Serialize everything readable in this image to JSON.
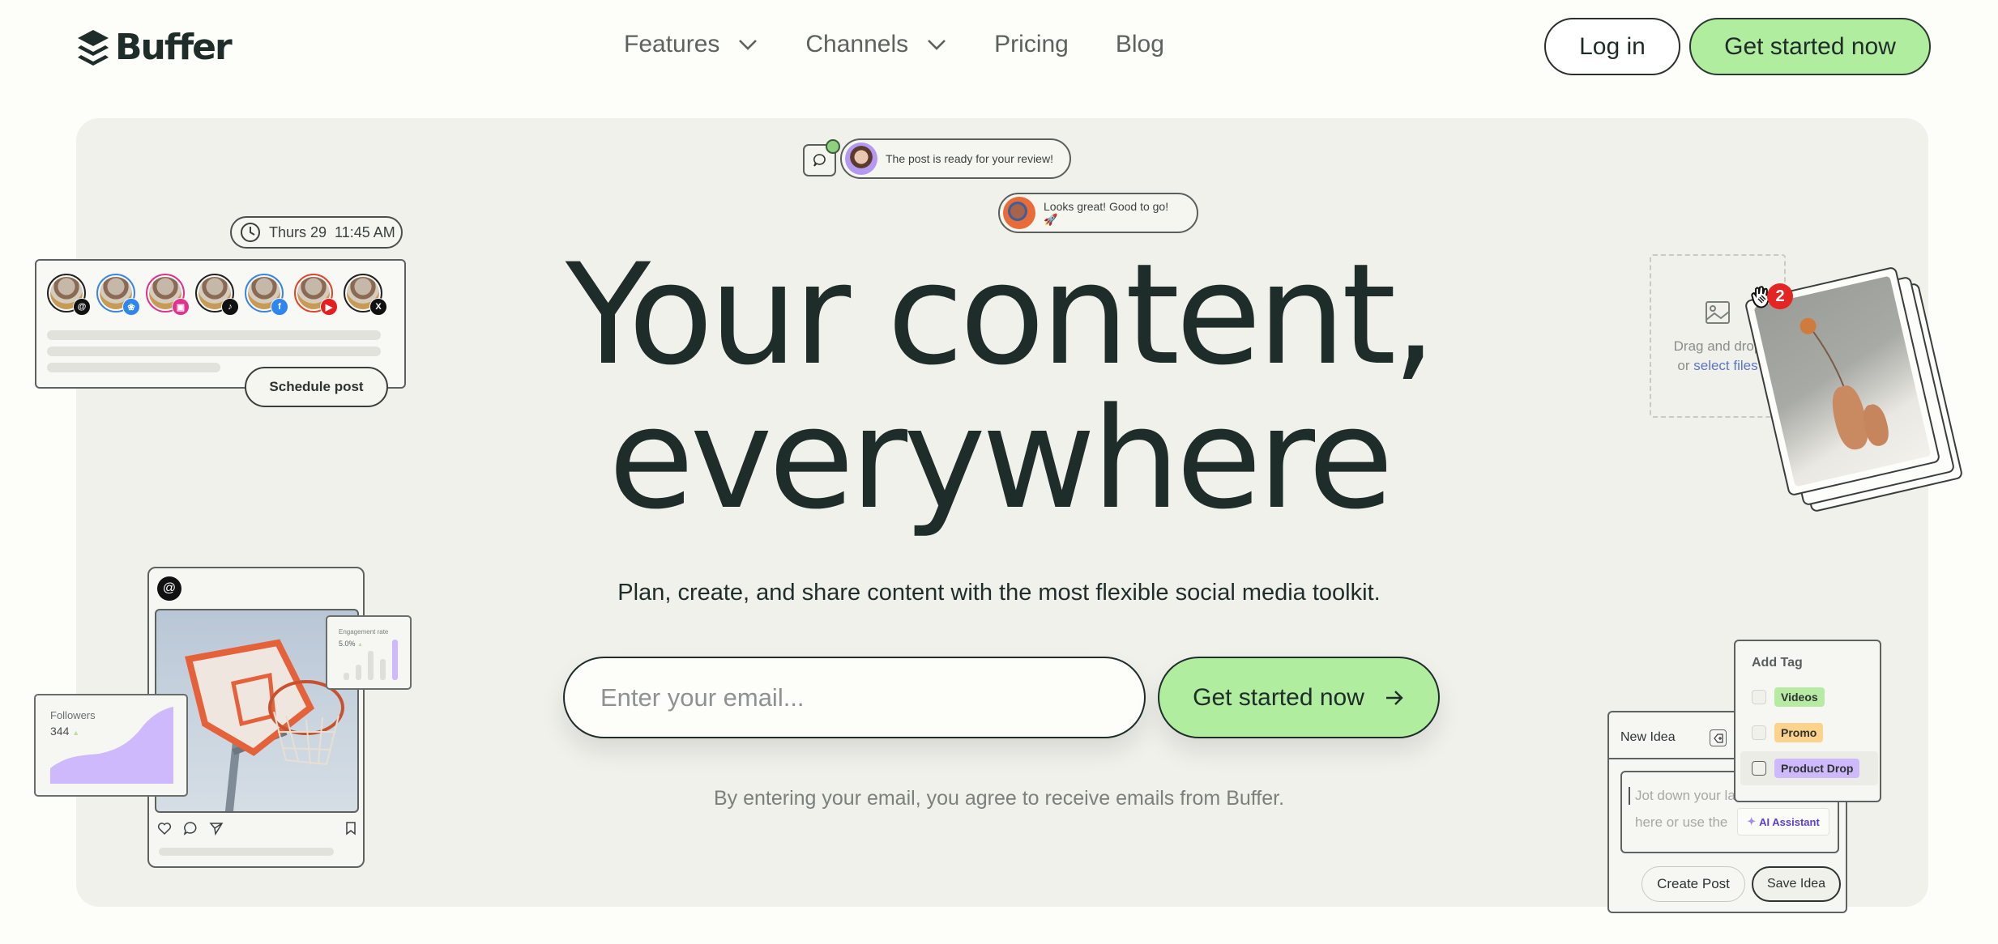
{
  "brand": {
    "name": "Buffer",
    "accent": "#b1ed9e",
    "text": "#1f2d2a",
    "hero_bg": "#f1f1ec"
  },
  "nav": {
    "items": [
      {
        "label": "Features",
        "has_dropdown": true
      },
      {
        "label": "Channels",
        "has_dropdown": true
      },
      {
        "label": "Pricing",
        "has_dropdown": false
      },
      {
        "label": "Blog",
        "has_dropdown": false
      }
    ],
    "login_label": "Log in",
    "cta_label": "Get started now"
  },
  "hero": {
    "headline_line1": "Your content,",
    "headline_line2": "everywhere",
    "subheadline": "Plan, create, and share content with the most flexible social media toolkit.",
    "email_placeholder": "Enter your email...",
    "email_value": "",
    "cta_label": "Get started now",
    "disclaimer": "By entering your email, you agree to receive emails from Buffer."
  },
  "chat": {
    "message1": "The post is ready for your review!",
    "message2": "Looks great! Good to go! 🚀"
  },
  "schedule_card": {
    "date_label": "Thurs 29",
    "time_label": "11:45 AM",
    "button_label": "Schedule post",
    "channels": [
      {
        "name": "threads",
        "ring": "#222222",
        "badge": "#111111",
        "glyph": "@"
      },
      {
        "name": "bluesky",
        "ring": "#3a86e0",
        "badge": "#2f86ee",
        "glyph": "❀"
      },
      {
        "name": "instagram",
        "ring": "#e0338e",
        "badge": "#e0338e",
        "glyph": "▣"
      },
      {
        "name": "tiktok",
        "ring": "#222222",
        "badge": "#111111",
        "glyph": "♪"
      },
      {
        "name": "facebook",
        "ring": "#3a86e0",
        "badge": "#2f86ee",
        "glyph": "f"
      },
      {
        "name": "youtube",
        "ring": "#e0442f",
        "badge": "#e41f1f",
        "glyph": "▶"
      },
      {
        "name": "x",
        "ring": "#222222",
        "badge": "#111111",
        "glyph": "X"
      }
    ]
  },
  "post_card": {
    "network": "threads"
  },
  "engagement_card": {
    "title": "Engagement rate",
    "value": "5.0%",
    "trend": "up",
    "bars": [
      0.18,
      0.38,
      0.72,
      0.52,
      1.0
    ]
  },
  "followers_card": {
    "title": "Followers",
    "value": "344",
    "trend": "up"
  },
  "upload": {
    "line1": "Drag and drop",
    "line2_prefix": "or ",
    "line2_link": "select files",
    "badge_count": "2"
  },
  "idea_card": {
    "title": "New Idea",
    "placeholder_line1": "Jot down your latest idea",
    "placeholder_line2": "here or use the",
    "ai_label": "AI Assistant",
    "create_label": "Create Post",
    "save_label": "Save Idea"
  },
  "tag_card": {
    "title": "Add Tag",
    "tags": [
      {
        "label": "Videos",
        "color": "#b7eba4",
        "checked": false
      },
      {
        "label": "Promo",
        "color": "#fdd28c",
        "checked": false
      },
      {
        "label": "Product Drop",
        "color": "#cdb9fb",
        "checked": false
      }
    ]
  }
}
